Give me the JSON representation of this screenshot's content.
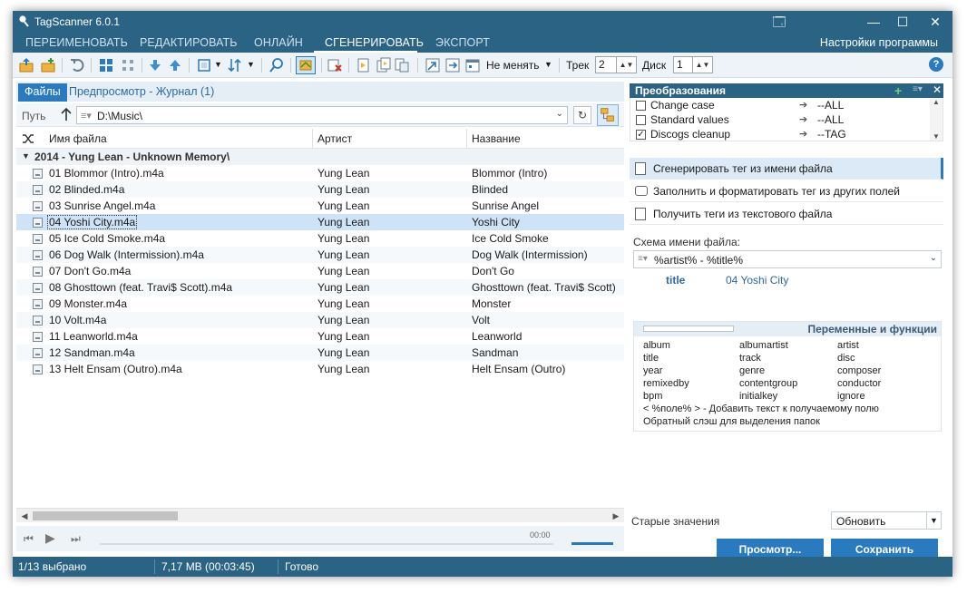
{
  "window": {
    "title": "TagScanner 6.0.1",
    "controls": [
      "🗔",
      "—",
      "☐",
      "✕"
    ]
  },
  "menu": {
    "items": [
      "ПЕРЕИМЕНОВАТЬ",
      "РЕДАКТИРОВАТЬ",
      "ОНЛАЙН",
      "СГЕНЕРИРОВАТЬ",
      "ЭКСПОРТ"
    ],
    "active": "СГЕНЕРИРОВАТЬ",
    "settings": "Настройки программы"
  },
  "toolbar": {
    "mode": "Не менять",
    "track_label": "Трек",
    "track_value": "2",
    "disc_label": "Диск",
    "disc_value": "1",
    "help": "?"
  },
  "left": {
    "tab_files": "Файлы",
    "tab_preview": "Предпросмотр - Журнал (1)",
    "path_label": "Путь",
    "path_value": "D:\\Music\\",
    "columns": [
      "Имя файла",
      "Артист",
      "Название"
    ],
    "group": "2014 - Yung Lean - Unknown Memory\\",
    "files": [
      {
        "name": "01 Blommor (Intro).m4a",
        "artist": "Yung Lean",
        "title": "Blommor (Intro)"
      },
      {
        "name": "02 Blinded.m4a",
        "artist": "Yung Lean",
        "title": "Blinded"
      },
      {
        "name": "03 Sunrise Angel.m4a",
        "artist": "Yung Lean",
        "title": "Sunrise Angel"
      },
      {
        "name": "04 Yoshi City.m4a",
        "artist": "Yung Lean",
        "title": "Yoshi City"
      },
      {
        "name": "05 Ice Cold Smoke.m4a",
        "artist": "Yung Lean",
        "title": "Ice Cold Smoke"
      },
      {
        "name": "06 Dog Walk (Intermission).m4a",
        "artist": "Yung Lean",
        "title": "Dog Walk (Intermission)"
      },
      {
        "name": "07 Don't Go.m4a",
        "artist": "Yung Lean",
        "title": "Don't Go"
      },
      {
        "name": "08 Ghosttown (feat. Travi$ Scott).m4a",
        "artist": "Yung Lean",
        "title": "Ghosttown (feat. Travi$ Scott)"
      },
      {
        "name": "09 Monster.m4a",
        "artist": "Yung Lean",
        "title": "Monster"
      },
      {
        "name": "10 Volt.m4a",
        "artist": "Yung Lean",
        "title": "Volt"
      },
      {
        "name": "11 Leanworld.m4a",
        "artist": "Yung Lean",
        "title": "Leanworld"
      },
      {
        "name": "12 Sandman.m4a",
        "artist": "Yung Lean",
        "title": "Sandman"
      },
      {
        "name": "13 Helt Ensam (Outro).m4a",
        "artist": "Yung Lean",
        "title": "Helt Ensam (Outro)"
      }
    ],
    "selected_index": 3,
    "player_time": "00:00"
  },
  "right": {
    "converters_title": "Преобразования",
    "converters": [
      {
        "name": "Change case",
        "value": "--ALL",
        "checked": false
      },
      {
        "name": "Standard values",
        "value": "--ALL",
        "checked": false
      },
      {
        "name": "Discogs cleanup",
        "value": "--TAG",
        "checked": true
      }
    ],
    "actions": [
      "Сгенерировать тег из имени файла",
      "Заполнить и форматировать тег из других полей",
      "Получить теги из текстового файла"
    ],
    "active_action": 0,
    "scheme_label": "Схема имени файла:",
    "scheme_value": "%artist% - %title%",
    "preview_key": "title",
    "preview_value": "04 Yoshi City",
    "vars_title": "Переменные и функции",
    "vars": [
      "album",
      "albumartist",
      "artist",
      "title",
      "track",
      "disc",
      "year",
      "genre",
      "composer",
      "remixedby",
      "contentgroup",
      "conductor",
      "bpm",
      "initialkey",
      "ignore"
    ],
    "vars_note1": "< %поле% > - Добавить текст к получаемому полю",
    "vars_note2": "Обратный слэш для выделения папок",
    "old_values_label": "Старые значения",
    "old_values_select": "Обновить",
    "btn_preview": "Просмотр...",
    "btn_save": "Сохранить"
  },
  "status": {
    "selected": "1/13 выбрано",
    "size": "7,17 MB (00:03:45)",
    "state": "Готово"
  },
  "colors": {
    "titlebar": "#2b6384",
    "accent": "#2a7ac0",
    "selected_row": "#cfe3f6"
  }
}
